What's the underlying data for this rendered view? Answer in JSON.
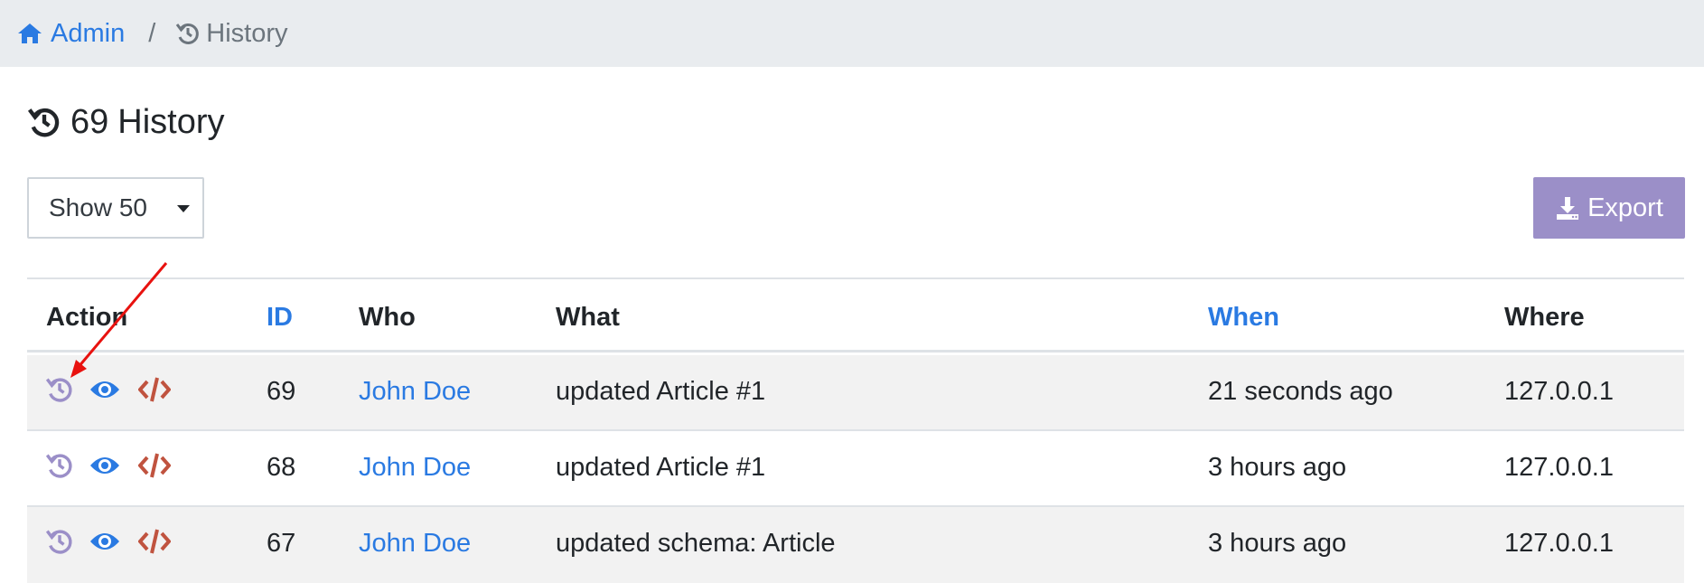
{
  "breadcrumb": {
    "admin_label": "Admin",
    "separator": "/",
    "current_label": "History"
  },
  "page": {
    "count": "69",
    "title": "History"
  },
  "toolbar": {
    "page_size_label": "Show 50",
    "export_label": "Export"
  },
  "table": {
    "headers": {
      "action": "Action",
      "id": "ID",
      "who": "Who",
      "what": "What",
      "when": "When",
      "where": "Where"
    },
    "rows": [
      {
        "id": "69",
        "who": "John Doe",
        "what": "updated Article #1",
        "when": "21 seconds ago",
        "where": "127.0.0.1"
      },
      {
        "id": "68",
        "who": "John Doe",
        "what": "updated Article #1",
        "when": "3 hours ago",
        "where": "127.0.0.1"
      },
      {
        "id": "67",
        "who": "John Doe",
        "what": "updated schema: Article",
        "when": "3 hours ago",
        "where": "127.0.0.1"
      }
    ]
  },
  "icons": {
    "home": "home-icon",
    "history": "history-icon",
    "restore": "restore-icon",
    "view": "eye-icon",
    "code": "code-icon",
    "download": "download-icon",
    "caret": "caret-down-icon"
  },
  "colors": {
    "link": "#2a7ae2",
    "restore_icon": "#9b8fc8",
    "code_icon": "#c0533f",
    "export_button": "#9b8fc8",
    "annotation_arrow": "#e8120f"
  }
}
